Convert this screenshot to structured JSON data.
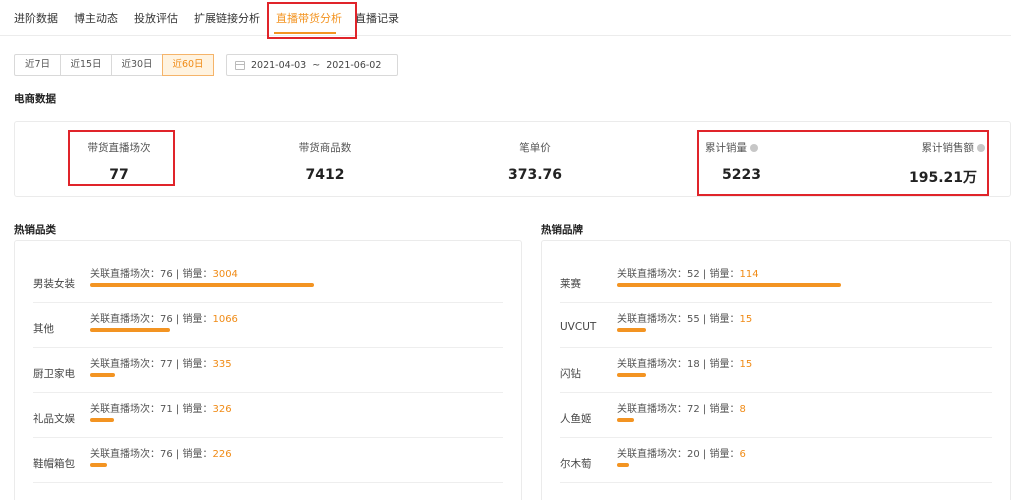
{
  "tabs": [
    {
      "label": "进阶数据"
    },
    {
      "label": "博主动态"
    },
    {
      "label": "投放评估"
    },
    {
      "label": "扩展链接分析"
    },
    {
      "label": "直播带货分析"
    },
    {
      "label": "直播记录"
    }
  ],
  "date_ranges": [
    {
      "label": "近7日"
    },
    {
      "label": "近15日"
    },
    {
      "label": "近30日"
    },
    {
      "label": "近60日"
    }
  ],
  "date_picker": {
    "start": "2021-04-03",
    "separator": "~",
    "end": "2021-06-02"
  },
  "ecommerce_title": "电商数据",
  "stats": [
    {
      "label": "带货直播场次",
      "value": "77"
    },
    {
      "label": "带货商品数",
      "value": "7412"
    },
    {
      "label": "笔单价",
      "value": "373.76"
    },
    {
      "label": "累计销量",
      "value": "5223"
    },
    {
      "label": "累计销售额",
      "value": "195.21万"
    }
  ],
  "hot_categories": {
    "title": "热销品类",
    "meta_prefix": "关联直播场次：",
    "meta_sep": " | 销量：",
    "items": [
      {
        "name": "男装女装",
        "sessions": "76",
        "sales": "3004",
        "bar_ratio": 1.0
      },
      {
        "name": "其他",
        "sessions": "76",
        "sales": "1066",
        "bar_ratio": 0.355
      },
      {
        "name": "厨卫家电",
        "sessions": "77",
        "sales": "335",
        "bar_ratio": 0.112
      },
      {
        "name": "礼品文娱",
        "sessions": "71",
        "sales": "326",
        "bar_ratio": 0.108
      },
      {
        "name": "鞋帽箱包",
        "sessions": "76",
        "sales": "226",
        "bar_ratio": 0.075
      }
    ]
  },
  "hot_brands": {
    "title": "热销品牌",
    "meta_prefix": "关联直播场次：",
    "meta_sep": " | 销量：",
    "items": [
      {
        "name": "莱赛",
        "sessions": "52",
        "sales": "114",
        "bar_ratio": 1.0
      },
      {
        "name": "UVCUT",
        "sessions": "55",
        "sales": "15",
        "bar_ratio": 0.13
      },
      {
        "name": "闪钻",
        "sessions": "18",
        "sales": "15",
        "bar_ratio": 0.13
      },
      {
        "name": "人鱼姬",
        "sessions": "72",
        "sales": "8",
        "bar_ratio": 0.075
      },
      {
        "name": "尔木萄",
        "sessions": "20",
        "sales": "6",
        "bar_ratio": 0.055
      }
    ]
  },
  "colors": {
    "accent": "#f39422",
    "highlight_box": "#e0242a"
  }
}
